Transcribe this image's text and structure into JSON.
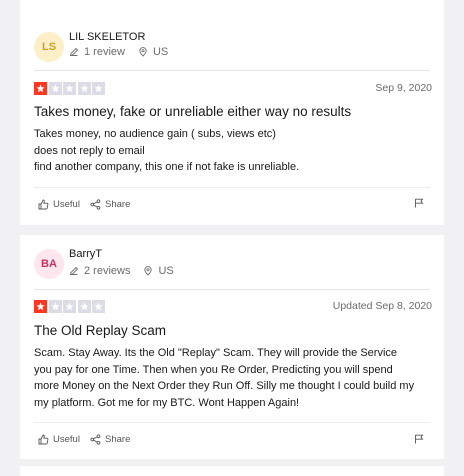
{
  "reviews": [
    {
      "avatar_initials": "LS",
      "avatar_bg": "#fdf0c9",
      "avatar_fg": "#c9a227",
      "reviewer_name": "LIL SKELETOR",
      "review_count": "1 review",
      "country": "US",
      "rating": 1,
      "rating_max": 5,
      "date": "Sep 9, 2020",
      "title": "Takes money, fake or unreliable either way no results",
      "body_lines": [
        "Takes money, no audience gain ( subs, views etc)",
        "does not reply to email",
        "find another company, this one if not fake is unreliable."
      ],
      "useful_label": "Useful",
      "share_label": "Share"
    },
    {
      "avatar_initials": "BA",
      "avatar_bg": "#fde6ee",
      "avatar_fg": "#c0345f",
      "reviewer_name": "BarryT",
      "review_count": "2 reviews",
      "country": "US",
      "rating": 1,
      "rating_max": 5,
      "date": "Updated Sep 8, 2020",
      "title": "The Old Replay Scam",
      "body_lines": [
        "Scam. Stay Away. Its the Old \"Replay\" Scam. They will provide the Service",
        "you pay for one Time. Then when you Re Order, Predicting you will spend",
        "more Money on the Next Order they Run Off. Silly me thought I could build my",
        "my platform. Got me for my BTC. Wont Happen Again!"
      ],
      "useful_label": "Useful",
      "share_label": "Share"
    }
  ],
  "colors": {
    "star_filled": "#ff3722",
    "star_empty": "#dcdce6",
    "page_bg": "#f1f1f3"
  }
}
